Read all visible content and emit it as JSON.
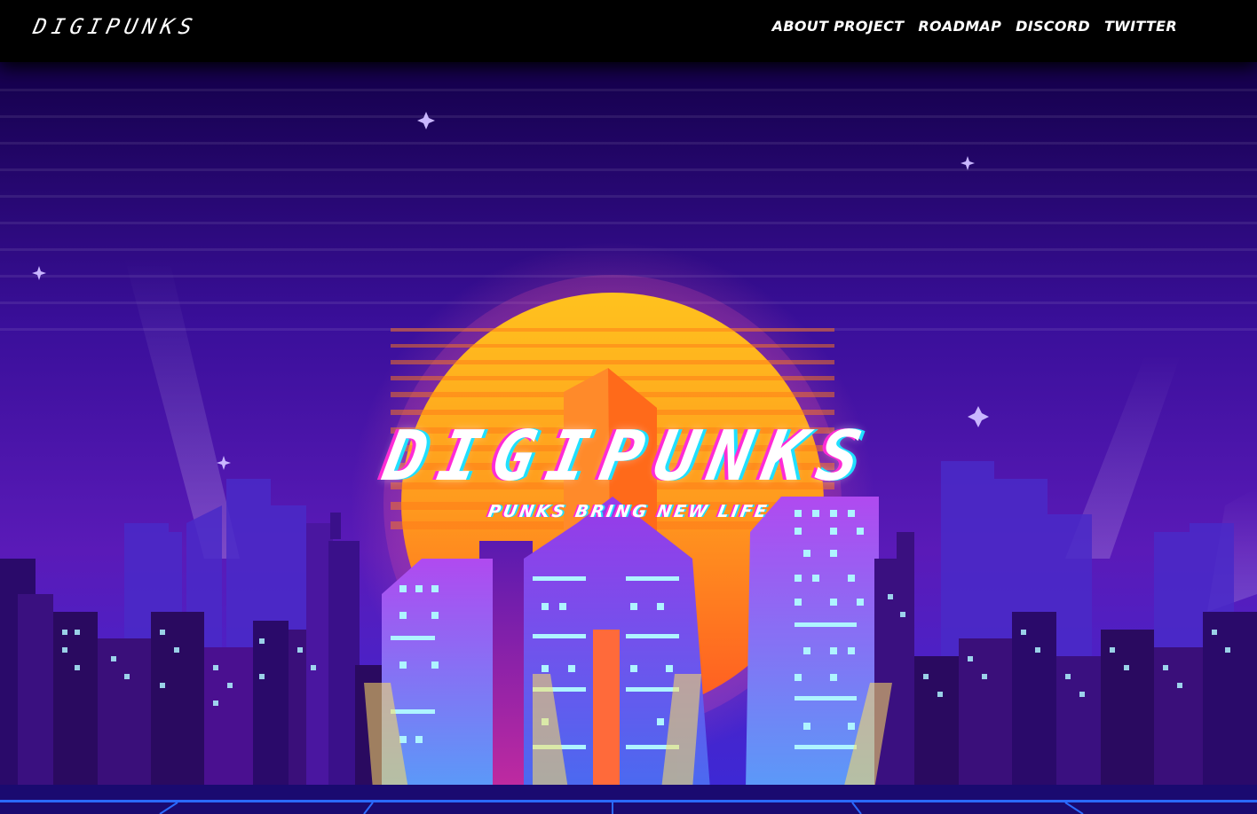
{
  "header": {
    "logo_text": "DIGIPUNKS",
    "nav": [
      "ABOUT PROJECT",
      "ROADMAP",
      "DISCORD",
      "TWITTER"
    ]
  },
  "hero": {
    "title": "DIGIPUNKS",
    "tagline": "PUNKS BRING NEW LIFE"
  },
  "colors": {
    "sky_top": "#1a0a5e",
    "sky_mid": "#5a1ab8",
    "sun_top": "#ffb820",
    "sun_bottom": "#ff5a1a",
    "building_purple": "#7a2ad8",
    "building_blue": "#4a8af0",
    "window": "#aef4ff",
    "glitch_pink": "#ff2bd6",
    "glitch_cyan": "#20e0ff"
  }
}
